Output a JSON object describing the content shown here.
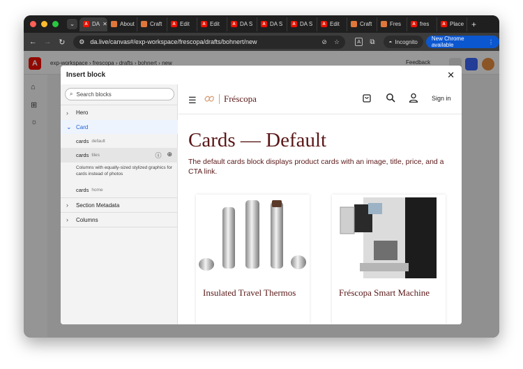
{
  "browser": {
    "tabs": [
      {
        "label": "DA"
      },
      {
        "label": "About"
      },
      {
        "label": "Craft"
      },
      {
        "label": "Edit"
      },
      {
        "label": "Edit"
      },
      {
        "label": "DA S"
      },
      {
        "label": "DA S"
      },
      {
        "label": "DA S"
      },
      {
        "label": "Edit"
      },
      {
        "label": "Craft"
      },
      {
        "label": "Fres"
      },
      {
        "label": "fres"
      },
      {
        "label": "Place"
      }
    ],
    "new_tab": "+",
    "url": "da.live/canvas#/exp-workspace/frescopa/drafts/bohnert/new",
    "incognito": "Incognito",
    "new_chrome": "New Chrome available"
  },
  "app": {
    "breadcrumb": "exp-workspace › frescopa › drafts › bohnert › new",
    "feedback": "Feedback"
  },
  "modal": {
    "title": "Insert block",
    "close": "✕",
    "search_placeholder": "Search blocks",
    "blocks": {
      "hero": "Hero",
      "card": "Card",
      "section_metadata": "Section Metadata",
      "columns": "Columns"
    },
    "card_items": [
      {
        "name": "cards",
        "variant": "default"
      },
      {
        "name": "cards",
        "variant": "tiles",
        "description": "Columns with equally-sized stylized graphics for cards instead of photos"
      },
      {
        "name": "cards",
        "variant": "home"
      }
    ]
  },
  "preview": {
    "brand": "Fréscopa",
    "sign_in": "Sign in",
    "title": "Cards — Default",
    "description": "The default cards block displays product cards with an image, title, price, and a CTA link.",
    "cards": [
      {
        "title": "Insulated Travel Thermos"
      },
      {
        "title": "Fréscopa Smart Machine"
      }
    ]
  },
  "colors": {
    "brand_maroon": "#5a1717",
    "adobe_red": "#eb1000",
    "chrome_blue": "#0b57d0",
    "selected_blue": "#1b5fd1"
  }
}
